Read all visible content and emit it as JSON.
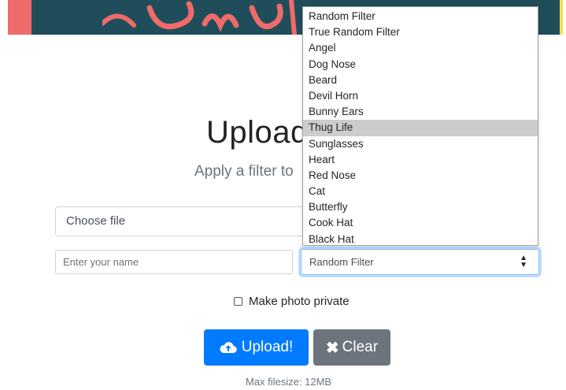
{
  "header": {
    "colors": {
      "banner": "#1f4e5a",
      "left_strip": "#f06a6a",
      "right_strip": "#f7e04a",
      "logo_text": "#f06a6a"
    }
  },
  "main": {
    "title": "Upload",
    "subtitle": "Apply a filter to",
    "file_input_label": "Choose file",
    "name_placeholder": "Enter your name",
    "filter_select": {
      "selected": "Random Filter",
      "highlighted": "Thug Life",
      "options": [
        "Random Filter",
        "True Random Filter",
        "Angel",
        "Dog Nose",
        "Beard",
        "Devil Horn",
        "Bunny Ears",
        "Thug Life",
        "Sunglasses",
        "Heart",
        "Red Nose",
        "Cat",
        "Butterfly",
        "Cook Hat",
        "Black Hat"
      ]
    },
    "private_label": "Make photo private",
    "upload_button": {
      "label": "Upload!",
      "icon": "cloud-upload-icon",
      "color": "#007bff"
    },
    "clear_button": {
      "label": "Clear",
      "icon": "close-icon",
      "color": "#6c757d"
    },
    "max_filesize": "Max filesize: 12MB"
  }
}
